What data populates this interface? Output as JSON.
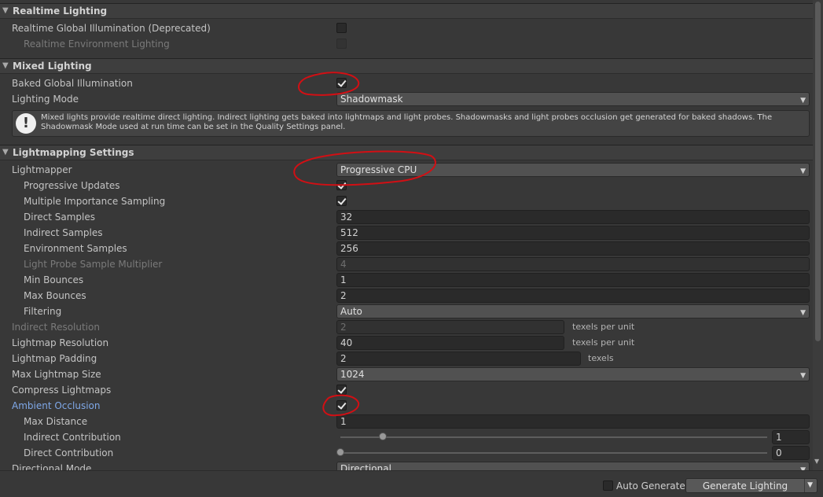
{
  "sections": {
    "realtime": {
      "title": "Realtime Lighting"
    },
    "mixed": {
      "title": "Mixed Lighting"
    },
    "lightmapping": {
      "title": "Lightmapping Settings"
    }
  },
  "realtime": {
    "gi_label": "Realtime Global Illumination (Deprecated)",
    "gi_checked": false,
    "env_label": "Realtime Environment Lighting",
    "env_checked": false
  },
  "mixed": {
    "baked_gi_label": "Baked Global Illumination",
    "baked_gi_checked": true,
    "mode_label": "Lighting Mode",
    "mode_value": "Shadowmask",
    "info_text": "Mixed lights provide realtime direct lighting. Indirect lighting gets baked into lightmaps and light probes. Shadowmasks and light probes occlusion get generated for baked shadows. The Shadowmask Mode used at run time can be set in the Quality Settings panel."
  },
  "lightmapping": {
    "lightmapper_label": "Lightmapper",
    "lightmapper_value": "Progressive CPU",
    "progressive_updates_label": "Progressive Updates",
    "progressive_updates_checked": true,
    "mis_label": "Multiple Importance Sampling",
    "mis_checked": true,
    "direct_samples_label": "Direct Samples",
    "direct_samples_value": "32",
    "indirect_samples_label": "Indirect Samples",
    "indirect_samples_value": "512",
    "env_samples_label": "Environment Samples",
    "env_samples_value": "256",
    "probe_mult_label": "Light Probe Sample Multiplier",
    "probe_mult_value": "4",
    "min_bounces_label": "Min Bounces",
    "min_bounces_value": "1",
    "max_bounces_label": "Max Bounces",
    "max_bounces_value": "2",
    "filtering_label": "Filtering",
    "filtering_value": "Auto",
    "indirect_res_label": "Indirect Resolution",
    "indirect_res_value": "2",
    "indirect_res_unit": "texels per unit",
    "lm_res_label": "Lightmap Resolution",
    "lm_res_value": "40",
    "lm_res_unit": "texels per unit",
    "padding_label": "Lightmap Padding",
    "padding_value": "2",
    "padding_unit": "texels",
    "max_size_label": "Max Lightmap Size",
    "max_size_value": "1024",
    "compress_label": "Compress Lightmaps",
    "compress_checked": true,
    "ao_label": "Ambient Occlusion",
    "ao_checked": true,
    "max_distance_label": "Max Distance",
    "max_distance_value": "1",
    "indirect_contrib_label": "Indirect Contribution",
    "indirect_contrib_value": "1",
    "indirect_contrib_fraction": 0.1,
    "direct_contrib_label": "Direct Contribution",
    "direct_contrib_value": "0",
    "direct_contrib_fraction": 0.0,
    "directional_mode_label": "Directional Mode",
    "directional_mode_value": "Directional"
  },
  "footer": {
    "auto_generate_label": "Auto Generate",
    "auto_generate_checked": false,
    "generate_label": "Generate Lighting"
  },
  "icons": {
    "section_arrow": "triangle-down",
    "info": "exclamation-circle",
    "dropdown": "triangle-down"
  },
  "colors": {
    "background": "#383838",
    "accent_label": "#7fa8e8",
    "annotation": "#d20f14"
  }
}
